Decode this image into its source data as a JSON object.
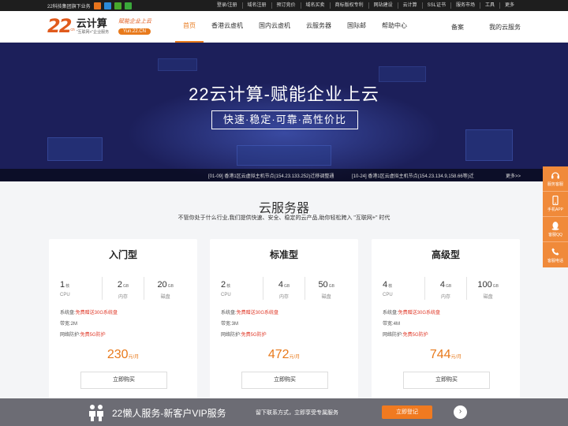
{
  "topbar": {
    "left_text": "22科技集团旗下业务",
    "social_icons": [
      "weibo-icon",
      "qzone-icon",
      "qq-icon",
      "wechat-icon"
    ],
    "links": [
      "登录/注册",
      "域名注册",
      "预订竞价",
      "域名买卖",
      "商标版权专利",
      "网站建设",
      "云计算",
      "SSL证书",
      "服务市场",
      "工具",
      "更多"
    ]
  },
  "header": {
    "logo_number": "22",
    "logo_cn": "cn",
    "logo_title": "云计算",
    "logo_tagline": "\"互联网+\"企业服务",
    "slogan": "赋能企业上云",
    "slogan_domain": "Yun.22.CN",
    "nav": [
      "首页",
      "香港云虚机",
      "国内云虚机",
      "云服务器",
      "国际邮",
      "帮助中心"
    ],
    "nav_active": 0,
    "nav_right": [
      "备案",
      "我的云服务"
    ]
  },
  "banner": {
    "title": "22云计算-赋能企业上云",
    "subtitle": "快速·稳定·可靠·高性价比",
    "news": [
      "[01-09] 香港1区云虚拟主机节点(154.23.133.252)迁移调整通",
      "[10-24] 香港1区云虚拟主机节点(154.23.134.9,158.66等)迁"
    ],
    "more": "更多>>"
  },
  "section": {
    "title": "云服务器",
    "desc": "不管你处于什么行业,我们提供快速、安全、稳定的云产品,助你轻松跨入 \"互联网+\" 时代"
  },
  "cards": [
    {
      "name": "入门型",
      "specs": [
        {
          "value": "1",
          "unit": "核",
          "label": "CPU"
        },
        {
          "value": "2",
          "unit": "GB",
          "label": "内存"
        },
        {
          "value": "20",
          "unit": "GB",
          "label": "磁盘"
        }
      ],
      "disk_label": "系统盘:",
      "disk_value": "免费赠送30G系统盘",
      "bandwidth_label": "带宽:",
      "bandwidth_value": "2M",
      "defense_label": "网络防护:",
      "defense_value": "免费5G防护",
      "price": "230",
      "price_unit": "元/月",
      "buy": "立即购买"
    },
    {
      "name": "标准型",
      "specs": [
        {
          "value": "2",
          "unit": "核",
          "label": "CPU"
        },
        {
          "value": "4",
          "unit": "GB",
          "label": "内存"
        },
        {
          "value": "50",
          "unit": "GB",
          "label": "磁盘"
        }
      ],
      "disk_label": "系统盘:",
      "disk_value": "免费赠送30G系统盘",
      "bandwidth_label": "带宽:",
      "bandwidth_value": "3M",
      "defense_label": "网络防护:",
      "defense_value": "免费5G防护",
      "price": "472",
      "price_unit": "元/月",
      "buy": "立即购买"
    },
    {
      "name": "高级型",
      "specs": [
        {
          "value": "4",
          "unit": "核",
          "label": "CPU"
        },
        {
          "value": "4",
          "unit": "GB",
          "label": "内存"
        },
        {
          "value": "100",
          "unit": "GB",
          "label": "磁盘"
        }
      ],
      "disk_label": "系统盘:",
      "disk_value": "免费赠送30G系统盘",
      "bandwidth_label": "带宽:",
      "bandwidth_value": "4M",
      "defense_label": "网络防护:",
      "defense_value": "免费5G防护",
      "price": "744",
      "price_unit": "元/月",
      "buy": "立即购买"
    }
  ],
  "sidebar": [
    {
      "icon": "headset-icon",
      "label": "服务客服"
    },
    {
      "icon": "phone-icon",
      "label": "手机APP"
    },
    {
      "icon": "qq-icon",
      "label": "客服QQ"
    },
    {
      "icon": "telephone-icon",
      "label": "客服电话"
    }
  ],
  "footer_bar": {
    "icon": "people-icon",
    "title": "22懒人服务-新客户VIP服务",
    "desc": "留下联系方式，立即享受专属服务",
    "button": "立即登记",
    "arrow": "›"
  },
  "colors": {
    "accent": "#e87a1c",
    "red": "#e03a2a",
    "banner_bg": "#1c1f5a",
    "topbar_bg": "#1e1e1e"
  }
}
